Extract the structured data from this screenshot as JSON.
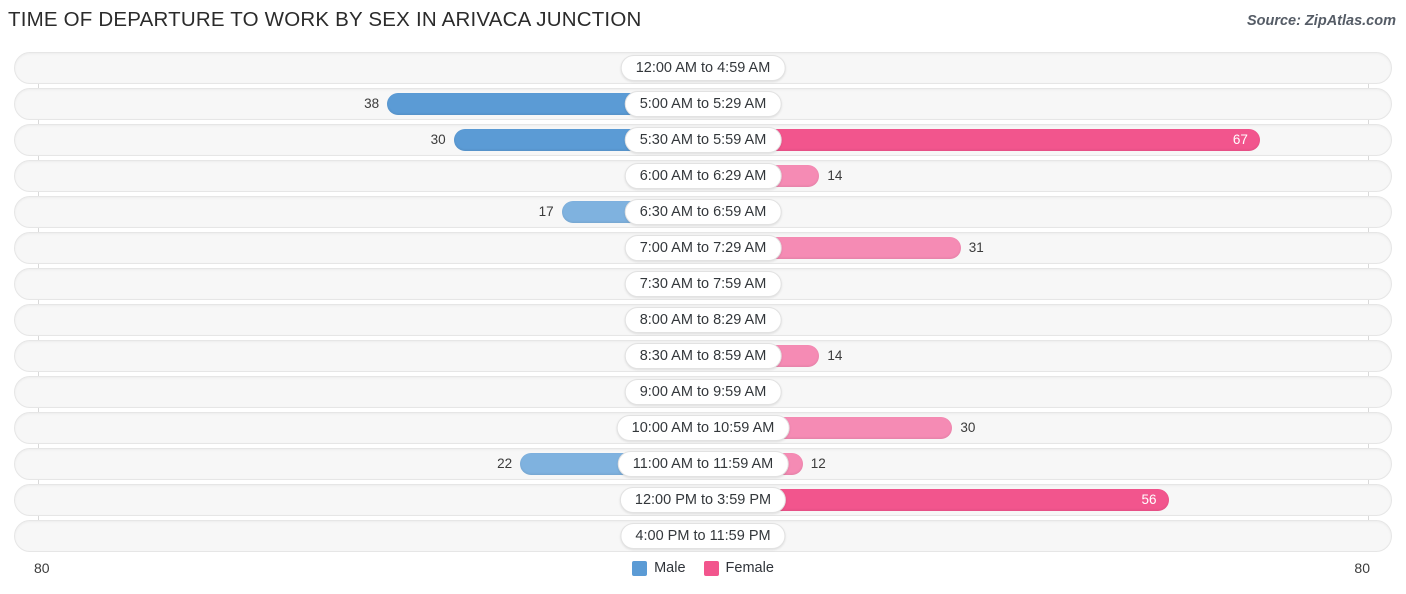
{
  "header": {
    "title": "TIME OF DEPARTURE TO WORK BY SEX IN ARIVACA JUNCTION",
    "source": "Source: ZipAtlas.com"
  },
  "footer": {
    "axis_min_label": "80",
    "axis_max_label": "80",
    "legend": [
      {
        "label": "Male",
        "color": "#5b9bd5"
      },
      {
        "label": "Female",
        "color": "#f2558d"
      }
    ]
  },
  "colors": {
    "male_strong": "#5b9bd5",
    "male_mid": "#7fb2df",
    "male_light": "#a8c8e8",
    "female_strong": "#f2558d",
    "female_mid": "#f58bb4",
    "female_light": "#f5a0c0",
    "track": "#f7f7f7",
    "gridline": "#d9d9d9",
    "text": "#3b3b3b"
  },
  "chart_data": {
    "type": "bar",
    "subtype": "diverging-horizontal",
    "title": "TIME OF DEPARTURE TO WORK BY SEX IN ARIVACA JUNCTION",
    "xlabel": "",
    "ylabel": "",
    "axis_max": 80,
    "axis_min": 0,
    "grid": true,
    "legend_position": "bottom-center",
    "categories": [
      "12:00 AM to 4:59 AM",
      "5:00 AM to 5:29 AM",
      "5:30 AM to 5:59 AM",
      "6:00 AM to 6:29 AM",
      "6:30 AM to 6:59 AM",
      "7:00 AM to 7:29 AM",
      "7:30 AM to 7:59 AM",
      "8:00 AM to 8:29 AM",
      "8:30 AM to 8:59 AM",
      "9:00 AM to 9:59 AM",
      "10:00 AM to 10:59 AM",
      "11:00 AM to 11:59 AM",
      "12:00 PM to 3:59 PM",
      "4:00 PM to 11:59 PM"
    ],
    "series": [
      {
        "name": "Male",
        "side": "left",
        "color": "#5b9bd5",
        "values": [
          0,
          38,
          30,
          0,
          17,
          0,
          0,
          0,
          0,
          0,
          0,
          22,
          0,
          0
        ]
      },
      {
        "name": "Female",
        "side": "right",
        "color": "#f2558d",
        "values": [
          0,
          1,
          67,
          14,
          0,
          31,
          0,
          0,
          14,
          0,
          30,
          12,
          56,
          0
        ]
      }
    ]
  }
}
